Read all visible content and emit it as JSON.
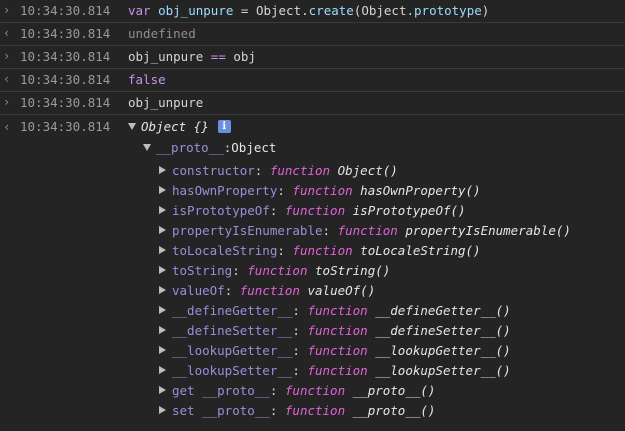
{
  "console": {
    "entries": [
      {
        "kind": "input",
        "timestamp": "10:34:30.814",
        "tokens": [
          {
            "text": "var",
            "style": "keyword"
          },
          {
            "text": " "
          },
          {
            "text": "obj_unpure",
            "style": "identifier"
          },
          {
            "text": " = Object."
          },
          {
            "text": "create",
            "style": "identifier"
          },
          {
            "text": "(Object."
          },
          {
            "text": "prototype",
            "style": "identifier"
          },
          {
            "text": ")"
          }
        ]
      },
      {
        "kind": "output",
        "timestamp": "10:34:30.814",
        "text": "undefined"
      },
      {
        "kind": "input",
        "timestamp": "10:34:30.814",
        "tokens": [
          {
            "text": "obj_unpure"
          },
          {
            "text": " == ",
            "style": "keyword"
          },
          {
            "text": "obj"
          }
        ]
      },
      {
        "kind": "output",
        "timestamp": "10:34:30.814",
        "text": "false"
      },
      {
        "kind": "input",
        "timestamp": "10:34:30.814",
        "tokens": [
          {
            "text": "obj_unpure"
          }
        ]
      }
    ],
    "result": {
      "timestamp": "10:34:30.814",
      "title": "Object {}",
      "info_badge": "i",
      "proto_label": "__proto__",
      "proto_value": "Object",
      "properties": [
        {
          "name": "constructor",
          "fn": "function",
          "sig": "Object()"
        },
        {
          "name": "hasOwnProperty",
          "fn": "function",
          "sig": "hasOwnProperty()"
        },
        {
          "name": "isPrototypeOf",
          "fn": "function",
          "sig": "isPrototypeOf()"
        },
        {
          "name": "propertyIsEnumerable",
          "fn": "function",
          "sig": "propertyIsEnumerable()"
        },
        {
          "name": "toLocaleString",
          "fn": "function",
          "sig": "toLocaleString()"
        },
        {
          "name": "toString",
          "fn": "function",
          "sig": "toString()"
        },
        {
          "name": "valueOf",
          "fn": "function",
          "sig": "valueOf()"
        },
        {
          "name": "__defineGetter__",
          "fn": "function",
          "sig": "__defineGetter__()"
        },
        {
          "name": "__defineSetter__",
          "fn": "function",
          "sig": "__defineSetter__()"
        },
        {
          "name": "__lookupGetter__",
          "fn": "function",
          "sig": "__lookupGetter__()"
        },
        {
          "name": "__lookupSetter__",
          "fn": "function",
          "sig": "__lookupSetter__()"
        },
        {
          "name": "get __proto__",
          "fn": "function",
          "sig": "__proto__()"
        },
        {
          "name": "set __proto__",
          "fn": "function",
          "sig": "__proto__()"
        }
      ]
    }
  },
  "icons": {
    "input_prompt": "›",
    "output_prompt": "‹"
  },
  "colors": {
    "background": "#242424",
    "keyword": "#c792ea",
    "identifier": "#9cdcfe",
    "property_name": "#9b8ed8",
    "function_keyword": "#e062d6",
    "info_badge": "#6b8fe0"
  }
}
